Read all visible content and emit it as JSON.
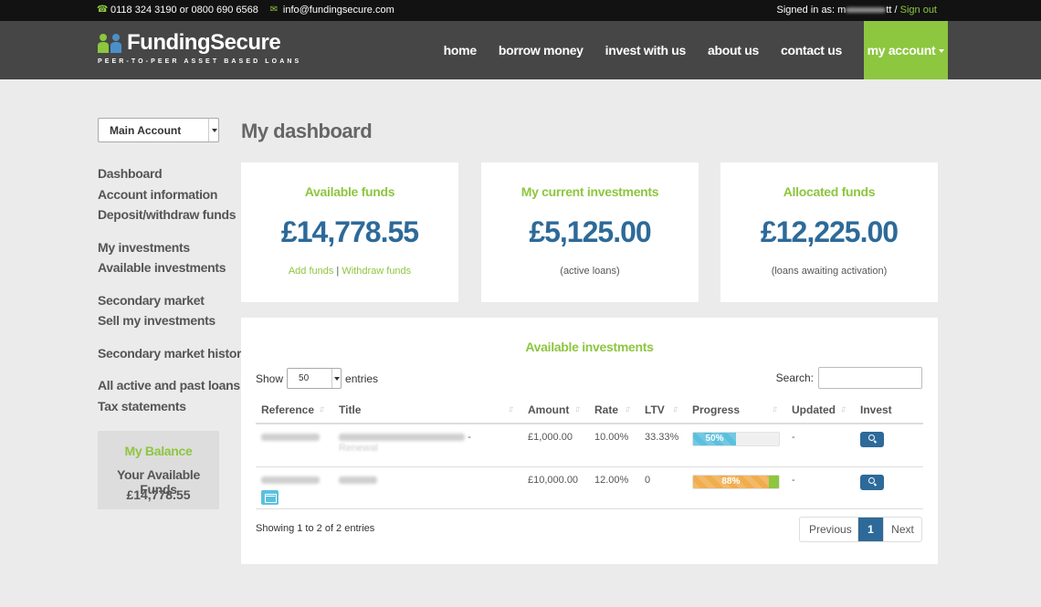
{
  "topbar": {
    "phone": "0118 324 3190 or 0800 690 6568",
    "email": "info@fundingsecure.com",
    "signed_in_label": "Signed in as: m",
    "signed_in_suffix": "tt / ",
    "sign_out": "Sign out"
  },
  "logo": {
    "name": "FundingSecure",
    "tagline": "PEER-TO-PEER ASSET BASED LOANS"
  },
  "nav": {
    "home": "home",
    "borrow": "borrow money",
    "invest": "invest with us",
    "about": "about us",
    "contact": "contact us",
    "account": "my account"
  },
  "sidebar": {
    "account_select": "Main Account",
    "links": [
      "Dashboard",
      "Account information",
      "Deposit/withdraw funds",
      "My investments",
      "Available investments",
      "Secondary market",
      "Sell my investments",
      "Secondary market history",
      "All active and past loans",
      "Tax statements"
    ],
    "balance": {
      "title": "My Balance",
      "label": "Your Available Funds",
      "value": "£14,778.55"
    }
  },
  "main": {
    "title": "My dashboard",
    "cards": [
      {
        "title": "Available funds",
        "value": "£14,778.55",
        "add": "Add funds",
        "sep": " | ",
        "withdraw": "Withdraw funds"
      },
      {
        "title": "My current investments",
        "value": "£5,125.00",
        "sub": "(active loans)"
      },
      {
        "title": "Allocated funds",
        "value": "£12,225.00",
        "sub": "(loans awaiting activation)"
      }
    ],
    "table": {
      "title": "Available investments",
      "show_label": "Show",
      "show_value": "50",
      "entries_label": "entries",
      "search_label": "Search:",
      "columns": [
        "Reference",
        "Title",
        "Amount",
        "Rate",
        "LTV",
        "Progress",
        "Updated",
        "Invest"
      ],
      "rows": [
        {
          "title_suffix": "-",
          "title_line2": "Renewal",
          "amount": "£1,000.00",
          "rate": "10.00%",
          "ltv": "33.33%",
          "progress": 50,
          "progress_label": "50%",
          "updated": "-"
        },
        {
          "amount": "£10,000.00",
          "rate": "12.00%",
          "ltv": "0",
          "progress": 88,
          "progress_label": "88%",
          "updated": "-"
        }
      ],
      "showing": "Showing 1 to 2 of 2 entries",
      "pager": {
        "prev": "Previous",
        "current": "1",
        "next": "Next"
      }
    }
  },
  "colors": {
    "accent_green": "#8dc63f",
    "value_blue": "#2d6a99",
    "header_bg": "#464646",
    "topbar_bg": "#121212"
  }
}
